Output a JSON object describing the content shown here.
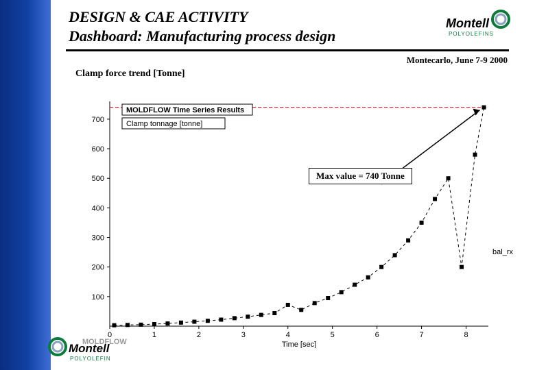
{
  "header": {
    "title1": "DESIGN & CAE ACTIVITY",
    "title2": "Dashboard: Manufacturing process design",
    "event": "Montecarlo, June 7-9 2000"
  },
  "brand": {
    "name": "Montell",
    "sub": "POLYOLEFINS"
  },
  "chart_section_title": "Clamp force trend [Tonne]",
  "annotation": {
    "max_label": "Max value = 740 Tonne"
  },
  "chart_data": {
    "type": "line",
    "title": "MOLDFLOW Time Series Results",
    "subtitle": "Clamp tonnage [tonne]",
    "xlabel": "Time [sec]",
    "ylabel": "",
    "xlim": [
      0,
      8.5
    ],
    "ylim": [
      0,
      760
    ],
    "y_ticks": [
      100,
      200,
      300,
      400,
      500,
      600,
      700
    ],
    "x_ticks": [
      0,
      1,
      2,
      3,
      4,
      5,
      6,
      7,
      8
    ],
    "ref_line_y": 740,
    "series": [
      {
        "name": "bal_rx",
        "x": [
          0.1,
          0.4,
          0.7,
          1.0,
          1.3,
          1.6,
          1.9,
          2.2,
          2.5,
          2.8,
          3.1,
          3.4,
          3.7,
          4.0,
          4.3,
          4.6,
          4.9,
          5.2,
          5.5,
          5.8,
          6.1,
          6.4,
          6.7,
          7.0,
          7.3,
          7.6,
          7.9,
          8.2,
          8.4
        ],
        "y": [
          3,
          4,
          5,
          7,
          9,
          12,
          15,
          18,
          22,
          27,
          32,
          38,
          44,
          72,
          55,
          78,
          95,
          115,
          140,
          165,
          200,
          240,
          290,
          350,
          430,
          500,
          200,
          580,
          740
        ]
      }
    ]
  },
  "watermark": "MOLDFLOW"
}
